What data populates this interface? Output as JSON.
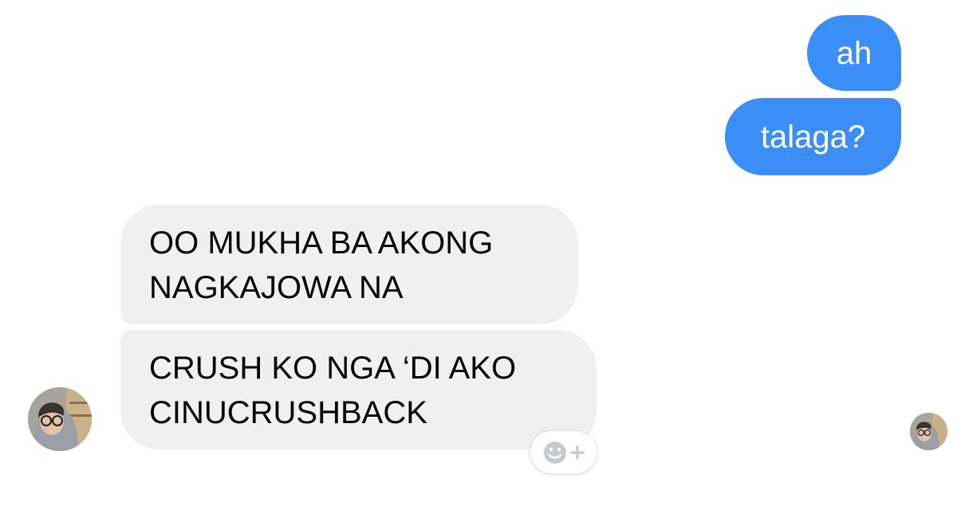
{
  "conversation": {
    "messages": [
      {
        "direction": "sent",
        "lines": [
          "ah"
        ]
      },
      {
        "direction": "sent",
        "lines": [
          "talaga?"
        ]
      },
      {
        "direction": "received",
        "lines": [
          "OO MUKHA BA AKONG",
          "NAGKAJOWA NA"
        ]
      },
      {
        "direction": "received",
        "lines": [
          "CRUSH KO NGA ‘DI AKO",
          "CINUCRUSHBACK"
        ]
      }
    ]
  },
  "colors": {
    "sent_bubble": "#3a8ef6",
    "received_bubble": "#f0f0f0",
    "text_dark": "#050505",
    "background": "#ffffff"
  },
  "icons": {
    "react_button": "smiley-plus-icon",
    "sender_avatar": "avatar",
    "seen_receipt": "seen-avatar"
  }
}
